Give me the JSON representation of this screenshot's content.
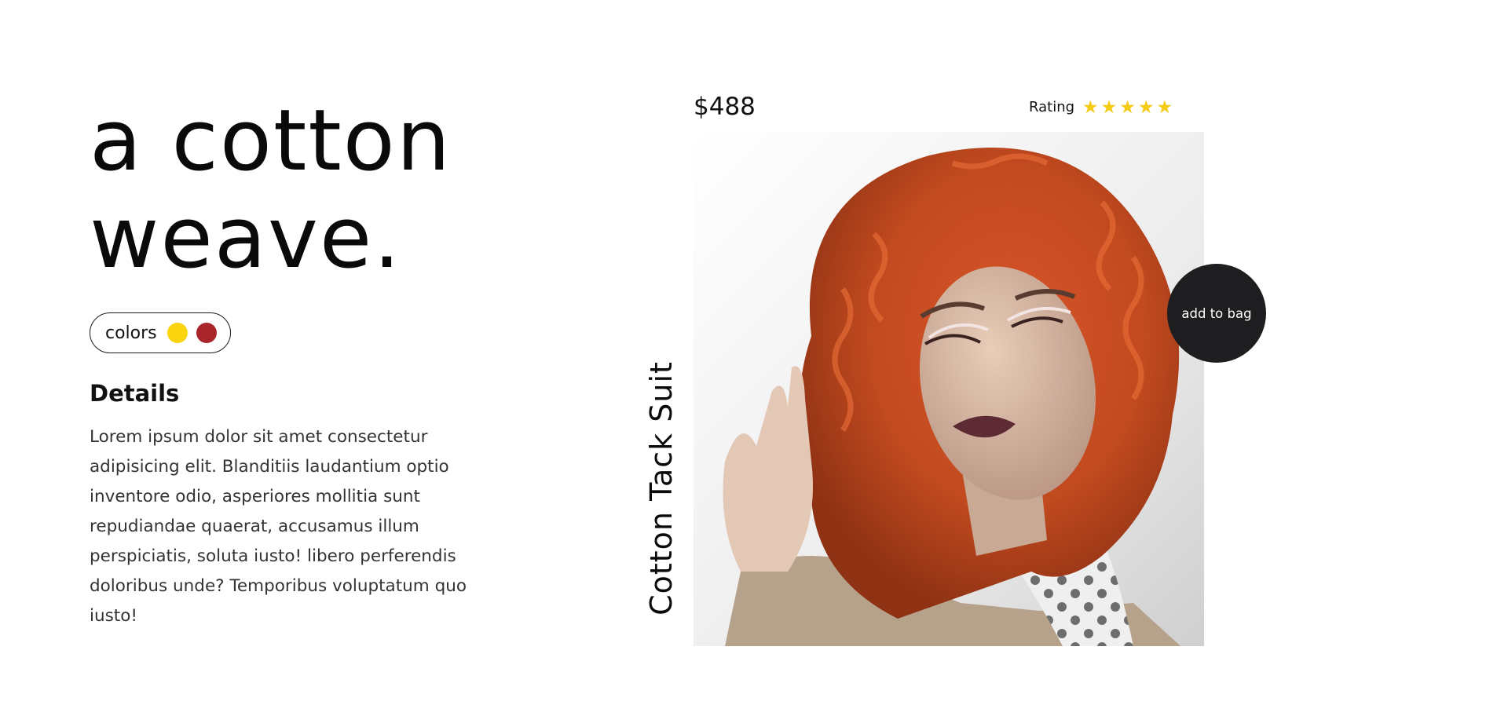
{
  "hero": {
    "line1": "a cotton",
    "line2": "weave."
  },
  "colors": {
    "label": "colors",
    "swatches": [
      {
        "name": "yellow",
        "hex": "#fad40f"
      },
      {
        "name": "red",
        "hex": "#a8262b"
      }
    ]
  },
  "details": {
    "title": "Details",
    "body": "Lorem ipsum dolor sit amet consectetur adipisicing elit. Blanditiis laudantium optio inventore odio, asperiores mollitia sunt repudiandae quaerat, accusamus illum perspiciatis, soluta iusto! libero perferendis doloribus unde? Temporibus voluptatum quo iusto!"
  },
  "product": {
    "price": "$488",
    "name": "Cotton Tack Suit",
    "rating_label": "Rating",
    "rating_value": 5,
    "rating_max": 5,
    "star_color": "#f6cb16",
    "add_to_bag_label": "add to bag",
    "image_icon": "model-portrait-image"
  }
}
